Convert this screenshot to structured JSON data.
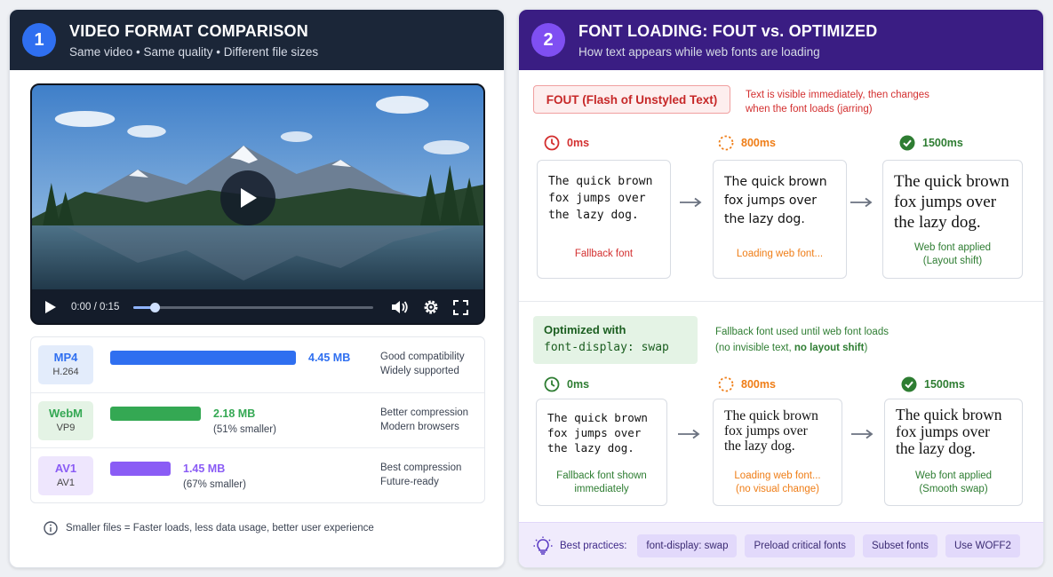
{
  "left": {
    "number": "1",
    "title": "VIDEO FORMAT COMPARISON",
    "subtitle": "Same video • Same quality • Different file sizes",
    "player": {
      "time": "0:00 / 0:15",
      "progress_fraction": 0.09
    },
    "formats": [
      {
        "name": "MP4",
        "codec": "H.264",
        "size": "4.45 MB",
        "smaller": "",
        "desc1": "Good compatibility",
        "desc2": "Widely supported",
        "color": "#2f6ff0",
        "badge_bg": "#e3ecfb",
        "size_mb": 4.45
      },
      {
        "name": "WebM",
        "codec": "VP9",
        "size": "2.18 MB",
        "smaller": "(51% smaller)",
        "desc1": "Better compression",
        "desc2": "Modern browsers",
        "color": "#34a853",
        "badge_bg": "#e4f3e5",
        "size_mb": 2.18
      },
      {
        "name": "AV1",
        "codec": "AV1",
        "size": "1.45 MB",
        "smaller": "(67% smaller)",
        "desc1": "Best compression",
        "desc2": "Future-ready",
        "color": "#8a5cf5",
        "badge_bg": "#eee6fd",
        "size_mb": 1.45
      }
    ],
    "note": "Smaller files = Faster loads, less data usage, better user experience"
  },
  "right": {
    "number": "2",
    "title": "FONT LOADING: FOUT vs. OPTIMIZED",
    "subtitle": "How text appears while web fonts are loading",
    "fout": {
      "label": "FOUT (Flash of Unstyled Text)",
      "desc_line1": "Text is visible immediately, then changes",
      "desc_line2": "when the font loads (jarring)",
      "stages": [
        {
          "time": "0ms",
          "icon": "clock-icon",
          "color": "#d32f2f",
          "caption1": "Fallback font",
          "caption2": "",
          "caption_color": "#d32f2f"
        },
        {
          "time": "800ms",
          "icon": "loading-icon",
          "color": "#ef7d16",
          "caption1": "Loading web font...",
          "caption2": "",
          "caption_color": "#ef7d16"
        },
        {
          "time": "1500ms",
          "icon": "check-icon",
          "color": "#2e7d32",
          "caption1": "Web font applied",
          "caption2": "(Layout shift)",
          "caption_color": "#2e7d32"
        }
      ]
    },
    "sample_text": {
      "line1": "The quick brown",
      "line2": "fox jumps over",
      "line3": "the lazy dog."
    },
    "optimized": {
      "label_line1": "Optimized with",
      "label_line2": "font-display: swap",
      "desc_line1": "Fallback font used until web font loads",
      "desc_line2_prefix": "(no invisible text, ",
      "desc_line2_bold": "no layout shift",
      "desc_line2_suffix": ")",
      "stages": [
        {
          "time": "0ms",
          "icon": "clock-icon",
          "color": "#2e7d32",
          "caption1": "Fallback font shown",
          "caption2": "immediately",
          "caption_color": "#2e7d32"
        },
        {
          "time": "800ms",
          "icon": "loading-icon",
          "color": "#ef7d16",
          "caption1": "Loading web font...",
          "caption2": "(no visual change)",
          "caption_color": "#ef7d16"
        },
        {
          "time": "1500ms",
          "icon": "check-icon",
          "color": "#2e7d32",
          "caption1": "Web font applied",
          "caption2": "(Smooth swap)",
          "caption_color": "#2e7d32"
        }
      ]
    },
    "best_practices": {
      "label": "Best practices:",
      "chips": [
        "font-display: swap",
        "Preload critical fonts",
        "Subset fonts",
        "Use WOFF2"
      ]
    }
  }
}
